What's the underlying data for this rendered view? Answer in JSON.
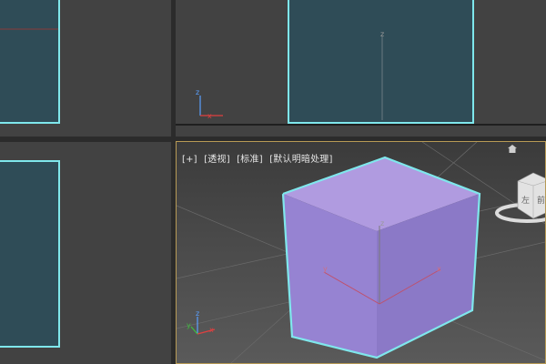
{
  "colors": {
    "viewport_bg": "#424242",
    "selection_cyan": "#7fe7ec",
    "active_border": "#b79a55",
    "box_fill": "#2f4c57",
    "cube_front": "#9a86d4",
    "cube_top": "#b09be0"
  },
  "viewports": {
    "perspective": {
      "label_plus": "[+]",
      "label_view": "[透视]",
      "label_shading": "[标准]",
      "label_lighting": "[默认明暗处理]"
    }
  },
  "axes": {
    "x": "x",
    "y": "y",
    "z": "z"
  },
  "viewcube": {
    "face_left": "左",
    "face_front": "前",
    "icon": "home-icon"
  }
}
